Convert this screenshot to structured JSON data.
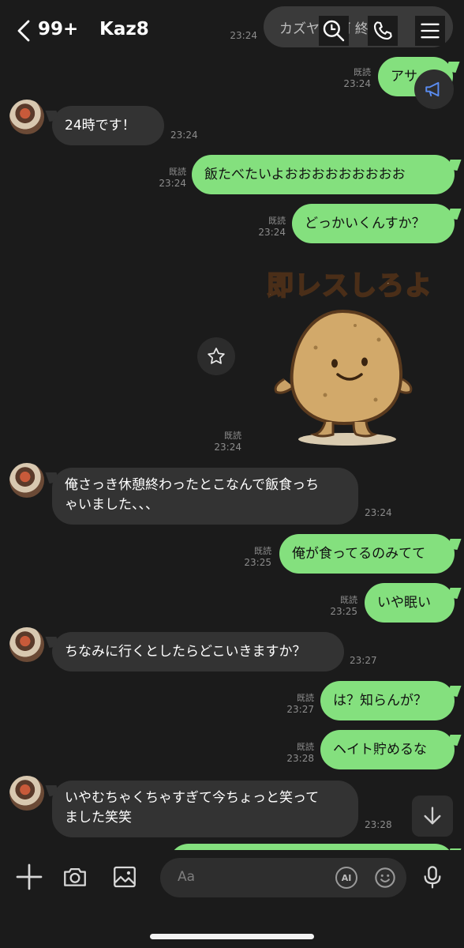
{
  "header": {
    "unread_count": "99+",
    "title": "Kaz8",
    "pinned_preview": "カズヤ 旧河 終わり",
    "pinned_time": "23:24"
  },
  "messages": [
    {
      "side": "out",
      "text": "アサ",
      "read": "既読",
      "time": "23:24"
    },
    {
      "side": "in",
      "text": "24時です！",
      "time": "23:24"
    },
    {
      "side": "out",
      "text": "飯たべたいよおおおおおおおおお",
      "read": "既読",
      "time": "23:24"
    },
    {
      "side": "out",
      "text": "どっかいくんすか？",
      "read": "既読",
      "time": "23:24"
    },
    {
      "side": "out",
      "type": "sticker",
      "sticker_text": "即レスしろよ",
      "read": "既読",
      "time": "23:24"
    },
    {
      "side": "in",
      "line1": "俺さっき休憩終わったとこなんで飯食っち",
      "line2": "ゃいました、、、",
      "time": "23:24"
    },
    {
      "side": "out",
      "text": "俺が食ってるのみてて",
      "read": "既読",
      "time": "23:25"
    },
    {
      "side": "out",
      "text": "いや眠い",
      "read": "既読",
      "time": "23:25"
    },
    {
      "side": "in",
      "text": "ちなみに行くとしたらどこいきますか？",
      "time": "23:27"
    },
    {
      "side": "out",
      "text": "は？知らんが？",
      "read": "既読",
      "time": "23:27"
    },
    {
      "side": "out",
      "text": "ヘイト貯めるな",
      "read": "既読",
      "time": "23:28"
    },
    {
      "side": "in",
      "line1": "いやむちゃくちゃすぎて今ちょっと笑って",
      "line2": "ました笑笑",
      "time": "23:28"
    }
  ],
  "composer": {
    "placeholder": "Aa",
    "ai_label": "AI"
  },
  "colors": {
    "background": "#1b1b1b",
    "bubble_out": "#84e07e",
    "bubble_in": "#333333",
    "meta_text": "#8c8c8c"
  },
  "icons": [
    "back-chevron-icon",
    "search-icon",
    "phone-icon",
    "menu-icon",
    "megaphone-icon",
    "star-icon",
    "arrow-down-icon",
    "plus-icon",
    "camera-icon",
    "image-icon",
    "ai-icon",
    "emoji-icon",
    "mic-icon"
  ]
}
